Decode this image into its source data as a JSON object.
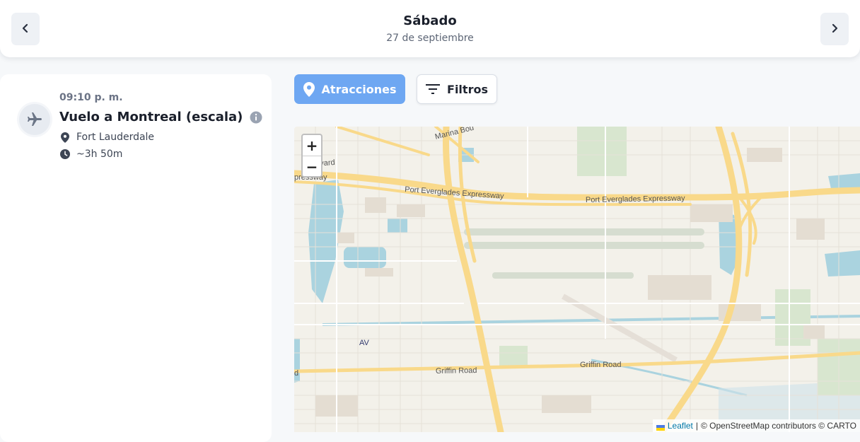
{
  "header": {
    "title": "Sábado",
    "date": "27 de septiembre",
    "prev_icon": "chevron-left-icon",
    "next_icon": "chevron-right-icon"
  },
  "event": {
    "time": "09:10 p. m.",
    "title": "Vuelo a Montreal (escala)",
    "location": "Fort Lauderdale",
    "duration": "~3h 50m",
    "icons": {
      "main": "airplane-icon",
      "info": "info-icon",
      "location": "map-pin-icon",
      "duration": "clock-icon"
    }
  },
  "toolbar": {
    "attractions_label": "Atracciones",
    "filters_label": "Filtros",
    "accent_color": "#6ea7f2"
  },
  "map": {
    "zoom_in": "+",
    "zoom_out": "−",
    "labels": {
      "marina": "Marina Bou",
      "boulevard": "levard",
      "expressway_edge": "pressway",
      "port_everglades_west": "Port Everglades Expressway",
      "port_everglades_east": "Port Everglades Expressway",
      "av": "AV",
      "griffin_west": "Griffin Road",
      "griffin_east": "Griffin Road",
      "road_edge": "d"
    },
    "attribution": {
      "leaflet": "Leaflet",
      "separator": "|",
      "credits": "© OpenStreetMap contributors © CARTO"
    }
  }
}
